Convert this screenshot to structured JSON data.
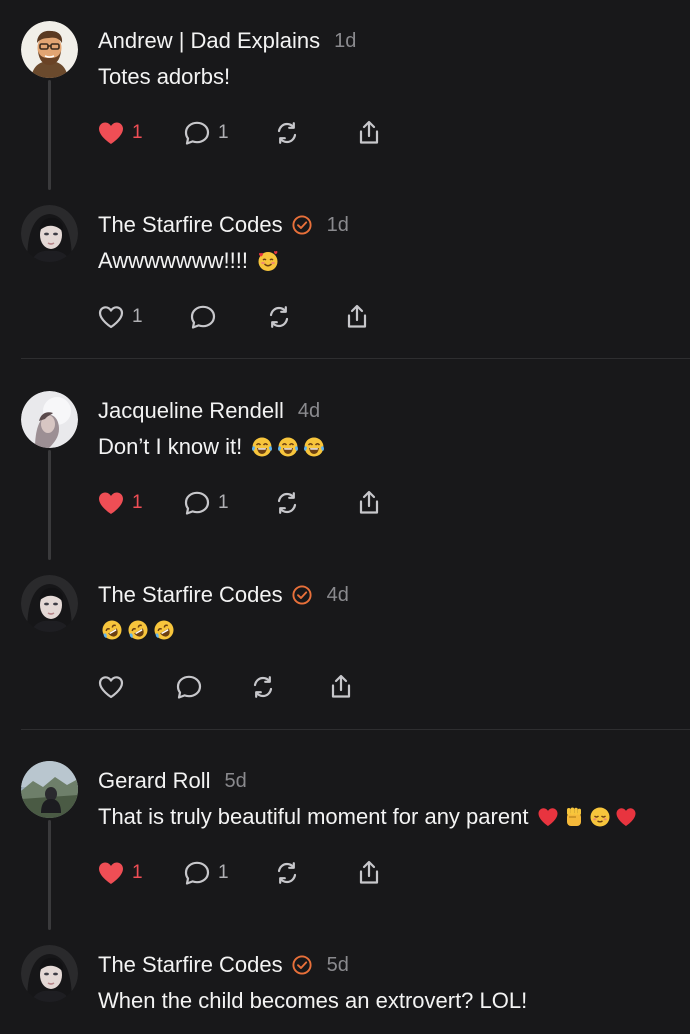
{
  "colors": {
    "background": "#18181a",
    "liked": "#ef4e55",
    "verified": "#e8703a",
    "muted": "#8a8a8e"
  },
  "posts": [
    {
      "author": "Andrew | Dad Explains",
      "verified": false,
      "time": "1d",
      "text": "Totes adorbs!",
      "emojis": [],
      "liked": true,
      "like_count": "1",
      "reply_count": "1",
      "avatar_icon": "cartoon-man-avatar"
    },
    {
      "author": "The Starfire Codes",
      "verified": true,
      "time": "1d",
      "text": "Awwwwwww!!!!",
      "emojis": [
        "smiling-face-with-hearts"
      ],
      "liked": false,
      "like_count": "1",
      "reply_count": "",
      "avatar_icon": "woman-portrait-avatar"
    },
    {
      "author": "Jacqueline Rendell",
      "verified": false,
      "time": "4d",
      "text": "Don’t I know it!",
      "emojis": [
        "tears-of-joy",
        "tears-of-joy",
        "tears-of-joy"
      ],
      "liked": true,
      "like_count": "1",
      "reply_count": "1",
      "avatar_icon": "light-portrait-avatar"
    },
    {
      "author": "The Starfire Codes",
      "verified": true,
      "time": "4d",
      "text": "",
      "emojis": [
        "rolling-on-floor-laughing",
        "rolling-on-floor-laughing",
        "rolling-on-floor-laughing"
      ],
      "liked": false,
      "like_count": "",
      "reply_count": "",
      "avatar_icon": "woman-portrait-avatar"
    },
    {
      "author": "Gerard Roll",
      "verified": false,
      "time": "5d",
      "text": "That is truly beautiful moment for any parent",
      "emojis": [
        "red-heart",
        "raised-fist",
        "relieved-face",
        "red-heart"
      ],
      "liked": true,
      "like_count": "1",
      "reply_count": "1",
      "avatar_icon": "landscape-person-avatar"
    },
    {
      "author": "The Starfire Codes",
      "verified": true,
      "time": "5d",
      "text": "When the child becomes an extrovert? LOL!",
      "emojis": [],
      "liked": false,
      "like_count": "",
      "reply_count": "",
      "avatar_icon": "woman-portrait-avatar"
    }
  ]
}
